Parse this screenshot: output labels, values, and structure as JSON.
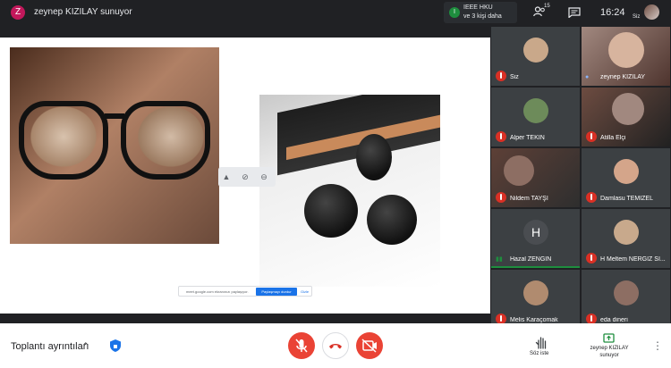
{
  "topbar": {
    "presenter_initial": "Z",
    "presenter_text": "zeynep KIZILAY sunuyor",
    "meeting_initial": "I",
    "meeting_line1": "IEEE HKU",
    "meeting_line2": "ve 3 kişi daha",
    "people_count": "15",
    "clock": "16:24",
    "self_label": "Siz"
  },
  "share": {
    "notice_text": "meet.google.com ekranınızı paylaşıyor.",
    "stop_label": "Paylaşmayı durdur",
    "hide_label": "Gizle"
  },
  "participants": [
    {
      "name": "Siz",
      "muted": true,
      "color": "#c9a88a"
    },
    {
      "name": "zeynep KIZILAY",
      "muted": false,
      "color": "#9e7b66"
    },
    {
      "name": "Alper TEKIN",
      "muted": true,
      "color": "#6d8b5a"
    },
    {
      "name": "Atilla Elçi",
      "muted": true,
      "color": "#7a4a3a"
    },
    {
      "name": "Nildem TAYŞI",
      "muted": true,
      "color": "#5d4037"
    },
    {
      "name": "Damlasu TEMIZEL",
      "muted": true,
      "color": "#d4a58a"
    },
    {
      "name": "Hazal ZENGIN",
      "muted": false,
      "color": "#3c4043"
    },
    {
      "name": "H Meltem NERGIZ SI...",
      "muted": true,
      "color": "#c8a98c"
    },
    {
      "name": "Melis Karaçomak",
      "muted": true,
      "color": "#b08b6f"
    },
    {
      "name": "eda dineri",
      "muted": true,
      "color": "#8d6e63"
    }
  ],
  "hazal_initial": "H",
  "bottombar": {
    "details_label": "Toplantı ayrıntıları",
    "raise_hand_label": "Söz iste",
    "presenting_label_1": "zeynep KIZILAY",
    "presenting_label_2": "sunuyor"
  },
  "colors": {
    "mute_red": "#d93025",
    "control_red": "#ea4335",
    "speaking_green": "#1e8e3e"
  }
}
